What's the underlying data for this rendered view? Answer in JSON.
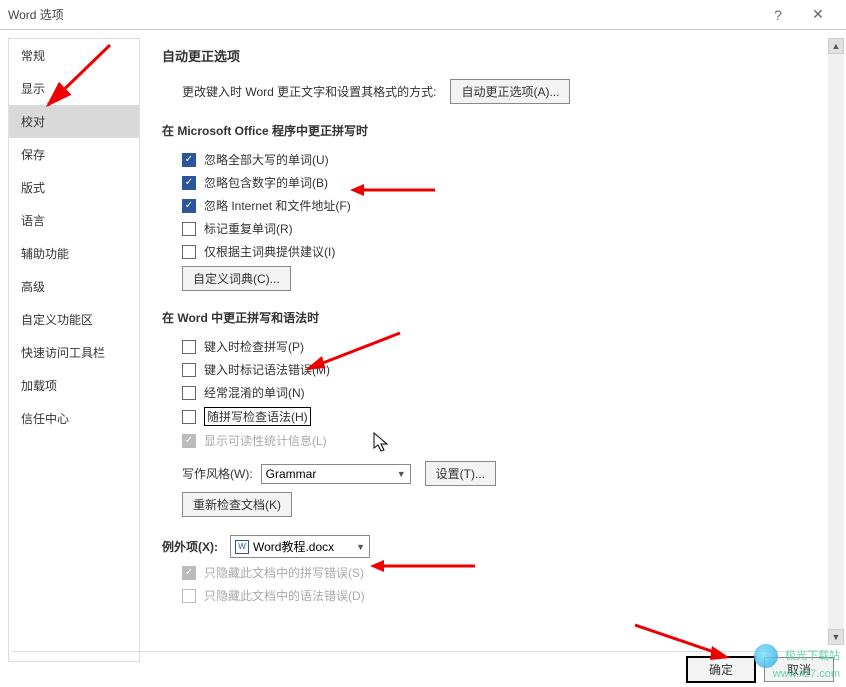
{
  "window": {
    "title": "Word 选项"
  },
  "sidebar": {
    "items": [
      {
        "label": "常规"
      },
      {
        "label": "显示"
      },
      {
        "label": "校对"
      },
      {
        "label": "保存"
      },
      {
        "label": "版式"
      },
      {
        "label": "语言"
      },
      {
        "label": "辅助功能"
      },
      {
        "label": "高级"
      },
      {
        "label": "自定义功能区"
      },
      {
        "label": "快速访问工具栏"
      },
      {
        "label": "加载项"
      },
      {
        "label": "信任中心"
      }
    ],
    "selected_index": 2
  },
  "autocorrect": {
    "heading": "自动更正选项",
    "desc": "更改键入时 Word 更正文字和设置其格式的方式:",
    "button": "自动更正选项(A)..."
  },
  "office_spell": {
    "heading": "在 Microsoft Office 程序中更正拼写时",
    "items": [
      {
        "checked": true,
        "label": "忽略全部大写的单词(U)"
      },
      {
        "checked": true,
        "label": "忽略包含数字的单词(B)"
      },
      {
        "checked": true,
        "label": "忽略 Internet 和文件地址(F)"
      },
      {
        "checked": false,
        "label": "标记重复单词(R)"
      },
      {
        "checked": false,
        "label": "仅根据主词典提供建议(I)"
      }
    ],
    "custom_dict_btn": "自定义词典(C)..."
  },
  "word_spell": {
    "heading": "在 Word 中更正拼写和语法时",
    "items": [
      {
        "checked": false,
        "disabled": false,
        "label": "键入时检查拼写(P)"
      },
      {
        "checked": false,
        "disabled": false,
        "label": "键入时标记语法错误(M)"
      },
      {
        "checked": false,
        "disabled": false,
        "label": "经常混淆的单词(N)"
      },
      {
        "checked": false,
        "disabled": false,
        "label": "随拼写检查语法(H)",
        "boxed": true
      },
      {
        "checked": true,
        "disabled": true,
        "label": "显示可读性统计信息(L)"
      }
    ],
    "style_label": "写作风格(W):",
    "style_value": "Grammar",
    "settings_btn": "设置(T)...",
    "recheck_btn": "重新检查文档(K)"
  },
  "exceptions": {
    "label": "例外项(X):",
    "doc_name": "Word教程.docx",
    "items": [
      {
        "checked": true,
        "disabled": true,
        "label": "只隐藏此文档中的拼写错误(S)"
      },
      {
        "checked": false,
        "disabled": true,
        "label": "只隐藏此文档中的语法错误(D)"
      }
    ]
  },
  "footer": {
    "ok": "确定",
    "cancel": "取消"
  },
  "watermark": {
    "line1": "极光下载站",
    "line2": "www.xz7.com"
  }
}
